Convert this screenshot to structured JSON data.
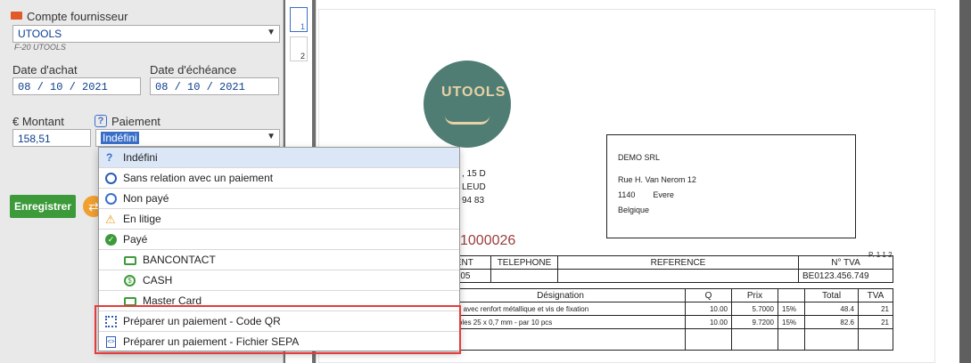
{
  "form": {
    "supplier_label": "Compte fournisseur",
    "supplier_value": "UTOOLS",
    "supplier_code": "F-20 UTOOLS",
    "purchase_date_label": "Date d'achat",
    "purchase_date": "08 / 10 / 2021",
    "due_date_label": "Date d'échéance",
    "due_date": "08 / 10 / 2021",
    "amount_label": "€ Montant",
    "amount_value": "158,51",
    "payment_label": "Paiement",
    "payment_value": "Indéfini",
    "save_label": "Enregistrer"
  },
  "thumbnails": [
    "1",
    "2"
  ],
  "dropdown": {
    "options": [
      {
        "label": "Indéfini",
        "icon": "question-icon"
      },
      {
        "label": "Sans relation avec un paiement",
        "icon": "prohibited-icon"
      },
      {
        "label": "Non payé",
        "icon": "alarm-clock-icon"
      },
      {
        "label": "En litige",
        "icon": "warning-icon"
      },
      {
        "label": "Payé",
        "icon": "check-circle-icon"
      },
      {
        "label": "BANCONTACT",
        "icon": "card-icon"
      },
      {
        "label": "CASH",
        "icon": "dollar-circle-icon"
      },
      {
        "label": "Master Card",
        "icon": "card-icon"
      },
      {
        "label": "Préparer un paiement - Code QR",
        "icon": "qr-code-icon"
      },
      {
        "label": "Préparer un paiement - Fichier SEPA",
        "icon": "file-code-icon"
      }
    ]
  },
  "document": {
    "logo_text": "UTOOLS",
    "recipient": {
      "name": "DEMO SRL",
      "street": "Rue H. Van Nerom 12",
      "postcode": "1140",
      "city": "Evere",
      "country": "Belgique"
    },
    "sender_fragments": [
      ", 15 D",
      "LEUD",
      "94 83"
    ],
    "invoice_number_fragment": "1000026",
    "page_index": "P. 1 1 2",
    "info_headers": [
      "IENT",
      "TELEPHONE",
      "REFERENCE",
      "N° TVA"
    ],
    "info_values": [
      "05B705",
      "",
      "",
      "BE0123.456.749"
    ],
    "lines_headers": [
      "Désignation",
      "Q",
      "Prix",
      "",
      "Total",
      "TVA"
    ],
    "lines": [
      {
        "desc": "25 mm avec renfort métallique et vis de fixation",
        "q": "10.00",
        "price": "5.7000",
        "vat_rate": "15%",
        "total": "48.4",
        "vat": "21"
      },
      {
        "desc": "cassables 25 x 0,7 mm - par 10 pcs",
        "q": "10.00",
        "price": "9.7200",
        "vat_rate": "15%",
        "total": "82.6",
        "vat": "21"
      }
    ]
  },
  "colors": {
    "save_button": "#3d9a3a",
    "highlight_border": "#e53b3b",
    "logo_bg": "#4f7d74"
  }
}
